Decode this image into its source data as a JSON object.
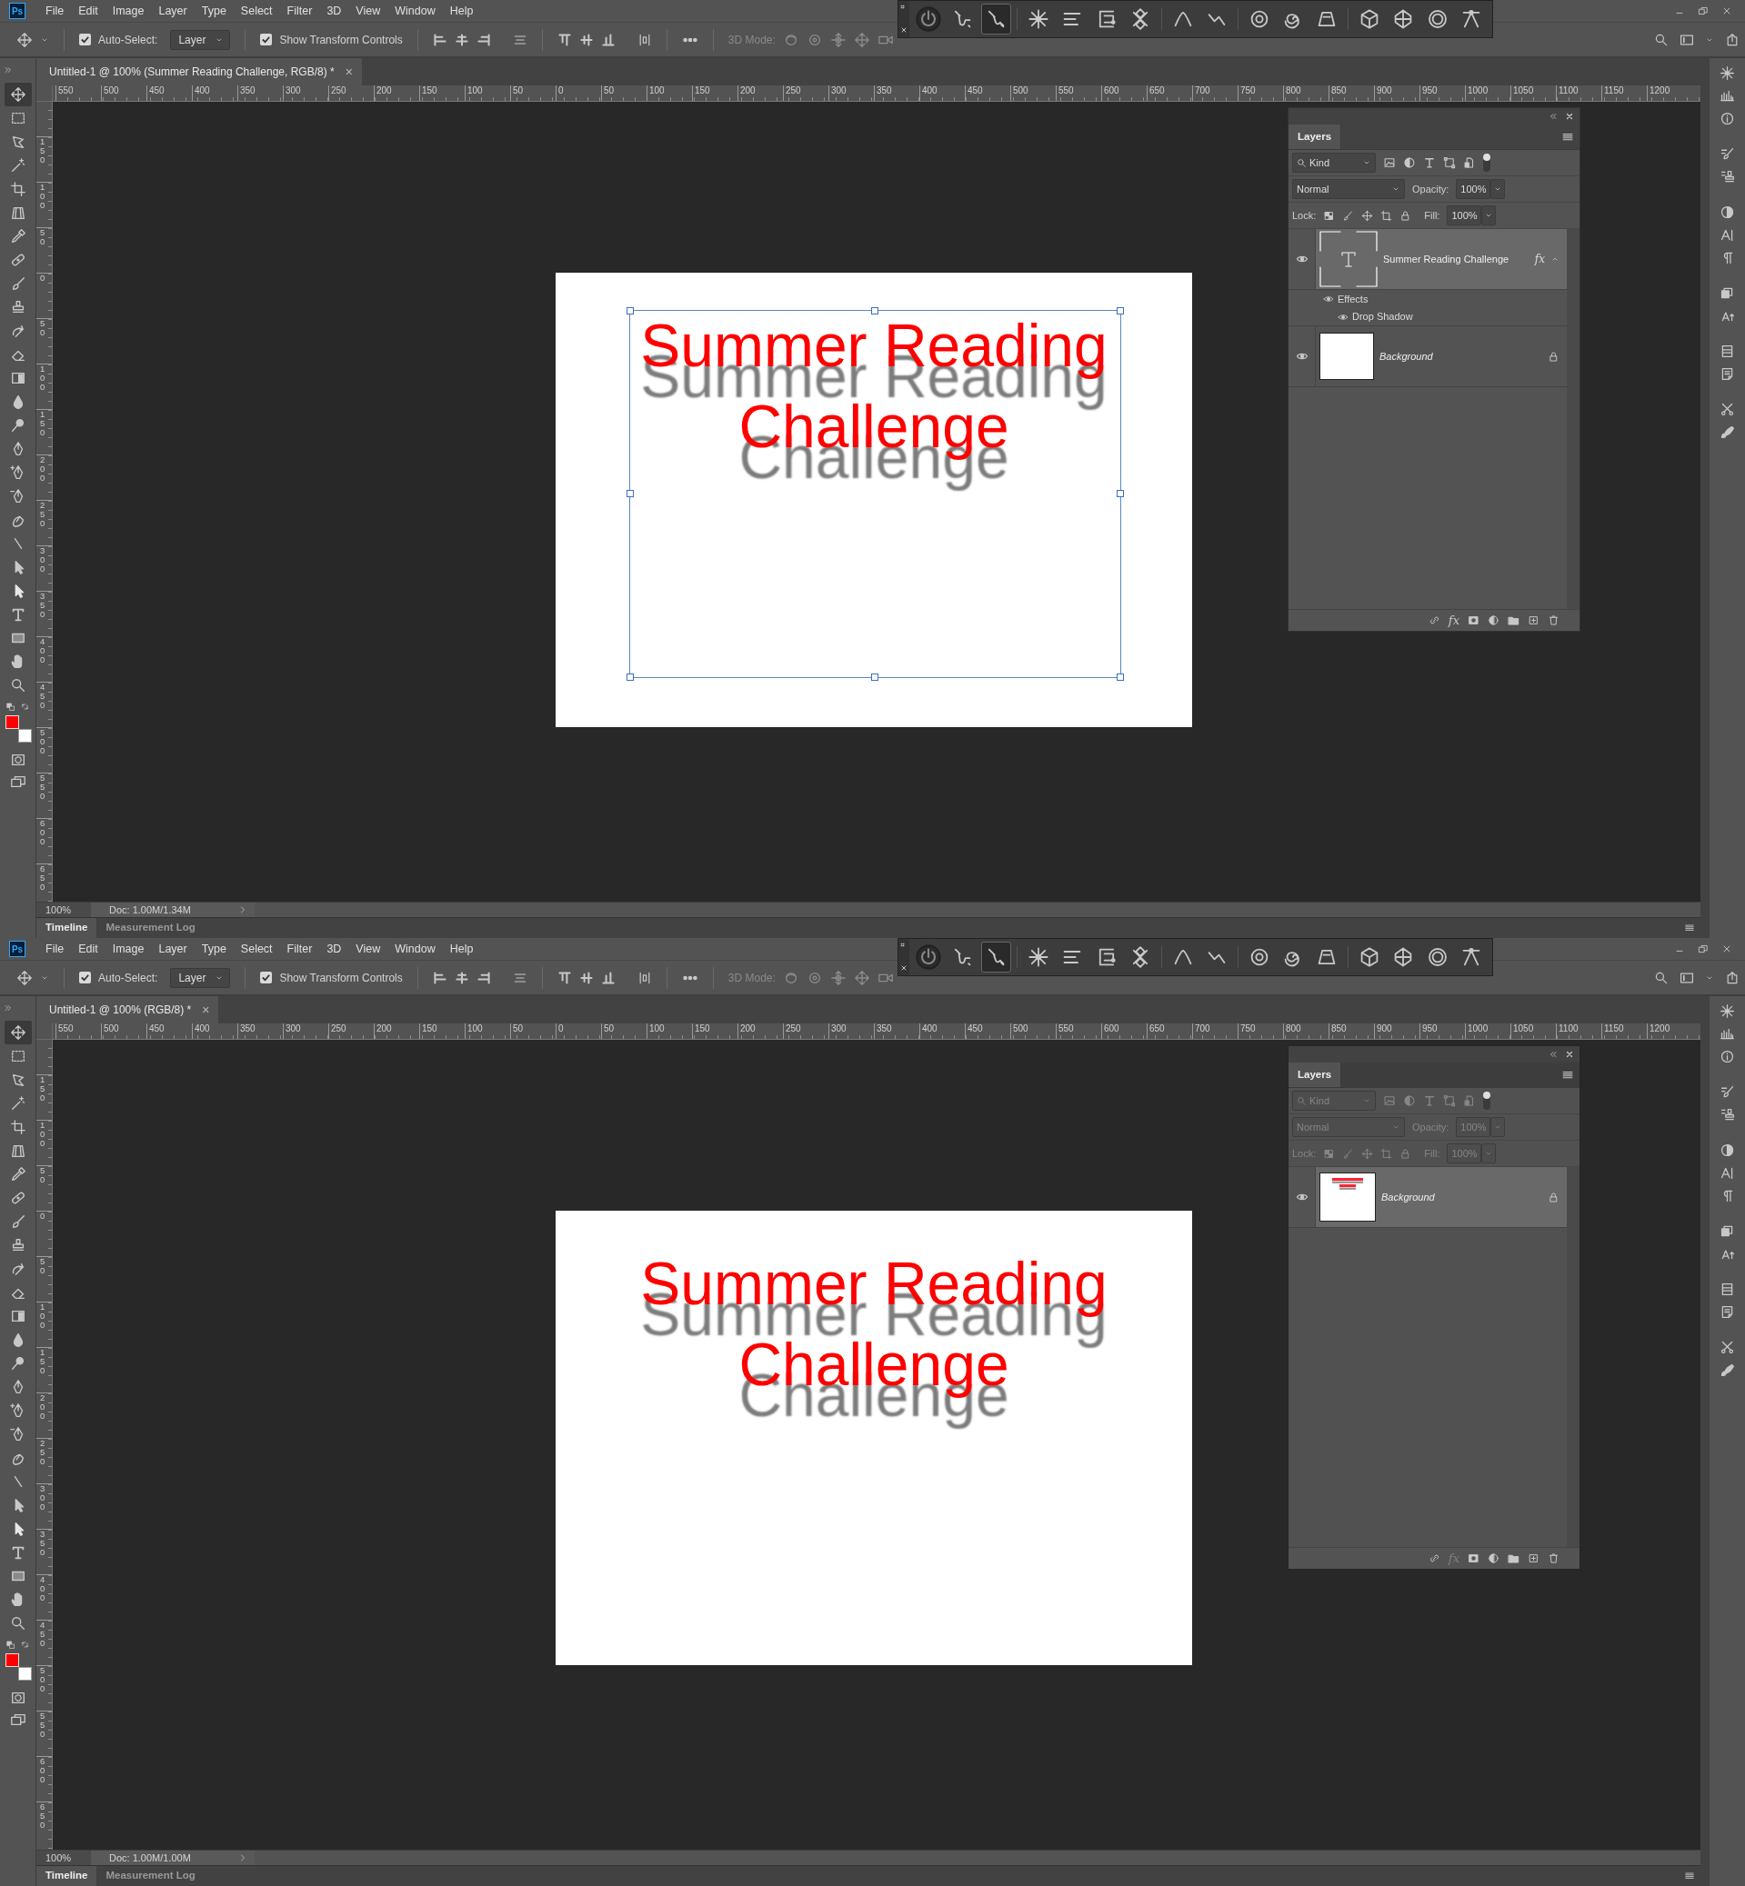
{
  "windows": [
    {
      "app_logo": "Ps",
      "menu": [
        "File",
        "Edit",
        "Image",
        "Layer",
        "Type",
        "Select",
        "Filter",
        "3D",
        "View",
        "Window",
        "Help"
      ],
      "options": {
        "auto_select": {
          "label": "Auto-Select:",
          "checked": true
        },
        "target": "Layer",
        "transform_controls": {
          "label": "Show Transform Controls",
          "checked": true
        },
        "mode_label": "3D Mode:"
      },
      "widget_tools": [
        {
          "selected": false
        },
        {
          "selected": false
        },
        {
          "selected": true
        },
        {
          "selected": false
        },
        {
          "selected": false
        },
        {
          "selected": false
        },
        {
          "selected": false
        },
        {
          "selected": false
        },
        {
          "selected": false
        },
        {
          "selected": false
        },
        {
          "selected": false
        },
        {
          "selected": false
        },
        {
          "selected": false
        },
        {
          "selected": false
        },
        {
          "selected": false
        },
        {
          "selected": false
        }
      ],
      "tools": [
        {
          "selected": true
        },
        {
          "selected": false
        },
        {
          "selected": false
        },
        {
          "selected": false
        },
        {
          "selected": false
        },
        {
          "selected": false
        },
        {
          "selected": false
        },
        {
          "selected": false
        },
        {
          "selected": false
        },
        {
          "selected": false
        },
        {
          "selected": false
        },
        {
          "selected": false
        },
        {
          "selected": false
        },
        {
          "selected": false
        },
        {
          "selected": false
        },
        {
          "selected": false
        },
        {
          "selected": false
        },
        {
          "selected": false
        },
        {
          "selected": false
        },
        {
          "selected": false
        },
        {
          "selected": false
        },
        {
          "selected": false
        },
        {
          "selected": false
        },
        {
          "selected": false
        },
        {
          "selected": false
        },
        {
          "selected": false
        }
      ],
      "swatches": [
        {
          "kind": "foreground",
          "color": "#ff0000"
        },
        {
          "kind": "background",
          "color": "#ffffff"
        }
      ],
      "document_tab": {
        "title": "Untitled-1 @ 100% (Summer Reading Challenge, RGB/8) *",
        "close": "×"
      },
      "ruler_h": [
        "550",
        "500",
        "450",
        "400",
        "350",
        "300",
        "250",
        "200",
        "150",
        "100",
        "50",
        "0",
        "50",
        "100",
        "150",
        "200",
        "250",
        "300",
        "350",
        "400",
        "450",
        "500",
        "550",
        "600",
        "650",
        "700",
        "750",
        "800",
        "850",
        "900",
        "950",
        "1000",
        "1050",
        "1100",
        "1150",
        "1200"
      ],
      "ruler_v": [
        "150",
        "100",
        "50",
        "0",
        "50",
        "100",
        "150",
        "200",
        "250",
        "300",
        "350",
        "400",
        "450",
        "500",
        "550",
        "600",
        "650"
      ],
      "document": {
        "lines": [
          "Summer Reading",
          "Challenge"
        ],
        "transform_box": true
      },
      "layers_panel": {
        "title": "Layers",
        "disabled": false,
        "filter": "Kind",
        "blend_mode": "Normal",
        "opacity_label": "Opacity:",
        "opacity": "100%",
        "lock_label": "Lock:",
        "fill_label": "Fill:",
        "fill": "100%",
        "footer_fx": "fx",
        "layers": [
          {
            "kind": "text",
            "name": "Summer Reading Challenge",
            "selected": true,
            "visible": true,
            "badge": "fx",
            "expanded": true,
            "effects": {
              "label": "Effects",
              "visible": true,
              "items": [
                {
                  "name": "Drop Shadow",
                  "visible": true
                }
              ]
            }
          },
          {
            "kind": "image",
            "name": "Background",
            "selected": false,
            "visible": true,
            "locked": true
          }
        ]
      },
      "status": {
        "zoom": "100%",
        "doc": "Doc: 1.00M/1.34M"
      },
      "bottom_tabs": [
        {
          "label": "Timeline",
          "selected": true
        },
        {
          "label": "Measurement Log",
          "selected": false
        }
      ]
    },
    {
      "app_logo": "Ps",
      "menu": [
        "File",
        "Edit",
        "Image",
        "Layer",
        "Type",
        "Select",
        "Filter",
        "3D",
        "View",
        "Window",
        "Help"
      ],
      "options": {
        "auto_select": {
          "label": "Auto-Select:",
          "checked": true
        },
        "target": "Layer",
        "transform_controls": {
          "label": "Show Transform Controls",
          "checked": true
        },
        "mode_label": "3D Mode:"
      },
      "widget_tools": [
        {
          "selected": false
        },
        {
          "selected": false
        },
        {
          "selected": true
        },
        {
          "selected": false
        },
        {
          "selected": false
        },
        {
          "selected": false
        },
        {
          "selected": false
        },
        {
          "selected": false
        },
        {
          "selected": false
        },
        {
          "selected": false
        },
        {
          "selected": false
        },
        {
          "selected": false
        },
        {
          "selected": false
        },
        {
          "selected": false
        },
        {
          "selected": false
        },
        {
          "selected": false
        }
      ],
      "tools": [
        {
          "selected": true
        },
        {
          "selected": false
        },
        {
          "selected": false
        },
        {
          "selected": false
        },
        {
          "selected": false
        },
        {
          "selected": false
        },
        {
          "selected": false
        },
        {
          "selected": false
        },
        {
          "selected": false
        },
        {
          "selected": false
        },
        {
          "selected": false
        },
        {
          "selected": false
        },
        {
          "selected": false
        },
        {
          "selected": false
        },
        {
          "selected": false
        },
        {
          "selected": false
        },
        {
          "selected": false
        },
        {
          "selected": false
        },
        {
          "selected": false
        },
        {
          "selected": false
        },
        {
          "selected": false
        },
        {
          "selected": false
        },
        {
          "selected": false
        },
        {
          "selected": false
        },
        {
          "selected": false
        },
        {
          "selected": false
        }
      ],
      "swatches": [
        {
          "kind": "foreground",
          "color": "#ff0000"
        },
        {
          "kind": "background",
          "color": "#ffffff"
        }
      ],
      "document_tab": {
        "title": "Untitled-1 @ 100% (RGB/8) *",
        "close": "×"
      },
      "ruler_h": [
        "550",
        "500",
        "450",
        "400",
        "350",
        "300",
        "250",
        "200",
        "150",
        "100",
        "50",
        "0",
        "50",
        "100",
        "150",
        "200",
        "250",
        "300",
        "350",
        "400",
        "450",
        "500",
        "550",
        "600",
        "650",
        "700",
        "750",
        "800",
        "850",
        "900",
        "950",
        "1000",
        "1050",
        "1100",
        "1150",
        "1200"
      ],
      "ruler_v": [
        "150",
        "100",
        "50",
        "0",
        "50",
        "100",
        "150",
        "200",
        "250",
        "300",
        "350",
        "400",
        "450",
        "500",
        "550",
        "600",
        "650"
      ],
      "document": {
        "lines": [
          "Summer Reading",
          "Challenge"
        ],
        "transform_box": false
      },
      "layers_panel": {
        "title": "Layers",
        "disabled": true,
        "filter": "Kind",
        "blend_mode": "Normal",
        "opacity_label": "Opacity:",
        "opacity": "100%",
        "lock_label": "Lock:",
        "fill_label": "Fill:",
        "fill": "100%",
        "footer_fx": "fx",
        "layers": [
          {
            "kind": "flattened",
            "name": "Background",
            "selected": true,
            "visible": true,
            "locked": true
          }
        ]
      },
      "status": {
        "zoom": "100%",
        "doc": "Doc: 1.00M/1.00M"
      },
      "bottom_tabs": [
        {
          "label": "Timeline",
          "selected": true
        },
        {
          "label": "Measurement Log",
          "selected": false
        }
      ]
    }
  ]
}
